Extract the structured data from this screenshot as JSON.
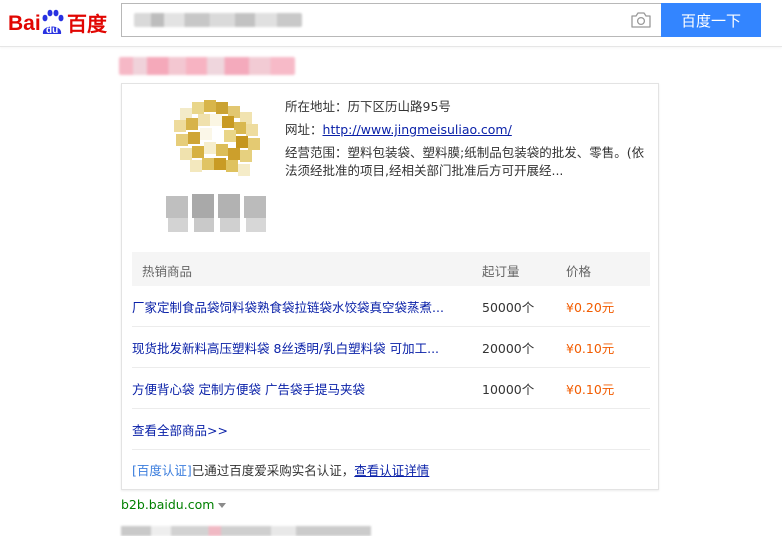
{
  "brand": {
    "logo_text_latin": "Bai",
    "logo_text_paw": "du",
    "logo_text_cn": "百度"
  },
  "search": {
    "button_label": "百度一下"
  },
  "card": {
    "address_label": "所在地址：",
    "address_value": "历下区历山路95号",
    "website_label": "网址：",
    "website_url": "http://www.jingmeisuliao.com/",
    "scope_label": "经营范围：",
    "scope_text": "塑料包装袋、塑料膜;纸制品包装袋的批发、零售。(依法须经批准的项目,经相关部门批准后方可开展经...",
    "table": {
      "headers": [
        "热销商品",
        "起订量",
        "价格"
      ],
      "rows": [
        {
          "name": "厂家定制食品袋饲料袋熟食袋拉链袋水饺袋真空袋蒸煮...",
          "qty": "50000个",
          "price": "¥0.20元"
        },
        {
          "name": "现货批发新料高压塑料袋 8丝透明/乳白塑料袋 可加工...",
          "qty": "20000个",
          "price": "¥0.10元"
        },
        {
          "name": "方便背心袋 定制方便袋 广告袋手提马夹袋",
          "qty": "10000个",
          "price": "¥0.10元"
        }
      ]
    },
    "view_all": "查看全部商品>>",
    "cert_tag": "[百度认证]",
    "cert_text": "已通过百度爱采购实名认证，",
    "cert_link": "查看认证详情"
  },
  "source": {
    "domain": "b2b.baidu.com"
  },
  "colors": {
    "accent": "#3385ff",
    "link": "#0a21a8",
    "price": "#f25c00",
    "source": "#008000",
    "logo_blue": "#2932e1",
    "logo_red": "#e10602"
  }
}
